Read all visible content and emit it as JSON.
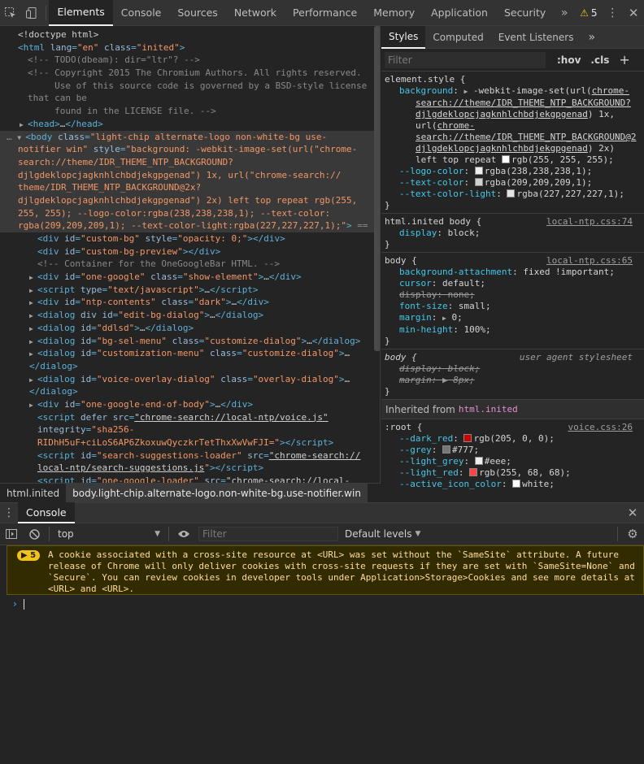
{
  "main_tabs": [
    "Elements",
    "Console",
    "Sources",
    "Network",
    "Performance",
    "Memory",
    "Application",
    "Security"
  ],
  "more_tabs_icon": "double-chevron-right-icon",
  "warning_count": "5",
  "styles_tabs": [
    "Styles",
    "Computed",
    "Event Listeners"
  ],
  "styles_filter_placeholder": "Filter",
  "hov_label": ":hov",
  "cls_label": ".cls",
  "breadcrumb": [
    "html.inited",
    "body.light-chip.alternate-logo.non-white-bg.use-notifier.win"
  ],
  "inherited_label": "Inherited from",
  "inherited_tag": "html.inited",
  "drawer_tab": "Console",
  "context_select": "top",
  "console_filter_placeholder": "Filter",
  "levels_select": "Default levels",
  "warning_badge": "5",
  "warning_text": "A cookie associated with a cross-site resource at <URL> was set without the `SameSite` attribute. A future release of Chrome will only deliver cookies with cross-site requests if they are set with `SameSite=None` and `Secure`. You can review cookies in developer tools under Application>Storage>Cookies and see more details at <URL> and <URL>.",
  "rules": {
    "element_style_selector": "element.style {",
    "r1_selector": "html.inited body",
    "r1_source": "local-ntp.css:74",
    "r2_selector": "body",
    "r2_source": "local-ntp.css:65",
    "r3_selector": "body",
    "r3_source": "user agent stylesheet",
    "r4_selector": ":root",
    "r4_source": "voice.css:26"
  },
  "colors": {
    "white_swatch": "#ffffff",
    "logo_swatch": "#eeeeee",
    "text_swatch": "#d1d1d1",
    "text_light_swatch": "#e3e3e3",
    "dark_red": "#cd0000",
    "grey": "#777777",
    "light_grey": "#eeeeee",
    "light_red": "#ff4444",
    "active_icon": "#ffffff"
  }
}
